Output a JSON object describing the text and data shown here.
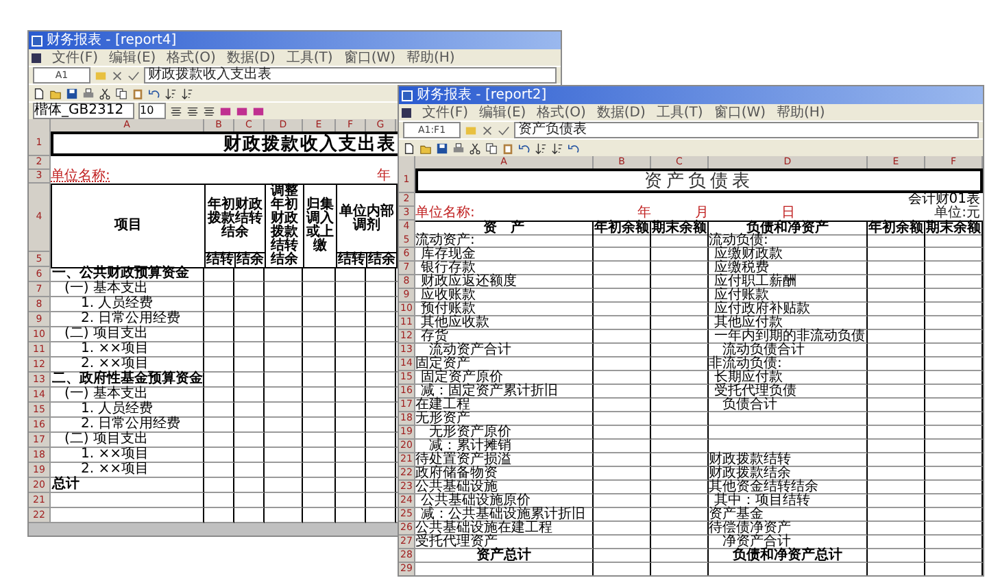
{
  "income_window": {
    "title": "财务报表 - [report4]",
    "menu": [
      "文件(F)",
      "编辑(E)",
      "格式(O)",
      "数据(D)",
      "工具(T)",
      "窗口(W)",
      "帮助(H)"
    ],
    "cell_ref": "A1",
    "formula": "财政拨款收入支出表",
    "font_name": "楷体_GB2312",
    "font_size": "10",
    "columns": [
      "A",
      "B",
      "C",
      "D",
      "E",
      "F",
      "G"
    ],
    "sheet": {
      "row_numbers": [
        "1",
        "2",
        "3",
        "4",
        "5"
      ],
      "title": "财政拨款收入支出表",
      "unit_name": "单位名称:",
      "year": "年",
      "headers": {
        "item": "项目",
        "carryover": "年初财政拨款结转结余",
        "adjust": "调整年初财政拨款结转结余",
        "transfer": "归集调入或上缴",
        "internal": "单位内部调剂",
        "sub": [
          "结转",
          "结余",
          "结转",
          "结余"
        ]
      },
      "rows": [
        {
          "n": "6",
          "label": "一、公共财政预算资金",
          "kind": "section"
        },
        {
          "n": "7",
          "label": "(一) 基本支出",
          "kind": "group"
        },
        {
          "n": "8",
          "label": "1. 人员经费",
          "kind": "item"
        },
        {
          "n": "9",
          "label": "2. 日常公用经费",
          "kind": "item"
        },
        {
          "n": "10",
          "label": "(二) 项目支出",
          "kind": "group"
        },
        {
          "n": "11",
          "label": "1. ××项目",
          "kind": "item"
        },
        {
          "n": "12",
          "label": "2. ××项目",
          "kind": "item"
        },
        {
          "n": "13",
          "label": "二、政府性基金预算资金",
          "kind": "section"
        },
        {
          "n": "14",
          "label": "(一) 基本支出",
          "kind": "group"
        },
        {
          "n": "15",
          "label": "1. 人员经费",
          "kind": "item"
        },
        {
          "n": "16",
          "label": "2. 日常公用经费",
          "kind": "item"
        },
        {
          "n": "17",
          "label": "(二) 项目支出",
          "kind": "group"
        },
        {
          "n": "18",
          "label": "1. ××项目",
          "kind": "item"
        },
        {
          "n": "19",
          "label": "2. ××项目",
          "kind": "item"
        },
        {
          "n": "20",
          "label": "总计",
          "kind": "total"
        },
        {
          "n": "21"
        },
        {
          "n": "22"
        }
      ]
    }
  },
  "balance_window": {
    "title": "财务报表 - [report2]",
    "menu": [
      "文件(F)",
      "编辑(E)",
      "格式(O)",
      "数据(D)",
      "工具(T)",
      "窗口(W)",
      "帮助(H)"
    ],
    "cell_ref": "A1:F1",
    "formula": "资产负债表",
    "columns": [
      "A",
      "B",
      "C",
      "D",
      "E",
      "F"
    ],
    "sheet": {
      "row_numbers": [
        "1",
        "2",
        "3",
        "4"
      ],
      "title": "资产负债表",
      "form_no": "会计财01表",
      "unit_name": "单位名称:",
      "year": "年",
      "month": "月",
      "day": "日",
      "currency": "单位:元",
      "headers": [
        "资　产",
        "年初余额",
        "期末余额",
        "负债和净资产",
        "年初余额",
        "期末余额"
      ],
      "rows": [
        {
          "n": "5",
          "asset": {
            "text": "流动资产:",
            "kind": "head"
          },
          "liability": {
            "text": "流动负债:",
            "kind": "head"
          }
        },
        {
          "n": "6",
          "asset": {
            "text": "库存现金",
            "kind": "item"
          },
          "liability": {
            "text": "应缴财政款",
            "kind": "item"
          }
        },
        {
          "n": "7",
          "asset": {
            "text": "银行存款",
            "kind": "item"
          },
          "liability": {
            "text": "应缴税费",
            "kind": "item"
          }
        },
        {
          "n": "8",
          "asset": {
            "text": "财政应返还额度",
            "kind": "item"
          },
          "liability": {
            "text": "应付职工薪酬",
            "kind": "item"
          }
        },
        {
          "n": "9",
          "asset": {
            "text": "应收账款",
            "kind": "item"
          },
          "liability": {
            "text": "应付账款",
            "kind": "item"
          }
        },
        {
          "n": "10",
          "asset": {
            "text": "预付账款",
            "kind": "item"
          },
          "liability": {
            "text": "应付政府补贴款",
            "kind": "item"
          }
        },
        {
          "n": "11",
          "asset": {
            "text": "其他应收款",
            "kind": "item"
          },
          "liability": {
            "text": "其他应付款",
            "kind": "item"
          }
        },
        {
          "n": "12",
          "asset": {
            "text": "存货",
            "kind": "item"
          },
          "liability": {
            "text": "一年内到期的非流动负债",
            "kind": "item"
          }
        },
        {
          "n": "13",
          "asset": {
            "text": "流动资产合计",
            "kind": "sub"
          },
          "liability": {
            "text": "流动负债合计",
            "kind": "sub"
          }
        },
        {
          "n": "14",
          "asset": {
            "text": "固定资产",
            "kind": "head"
          },
          "liability": {
            "text": "非流动负债:",
            "kind": "head"
          }
        },
        {
          "n": "15",
          "asset": {
            "text": "固定资产原价",
            "kind": "item"
          },
          "liability": {
            "text": "长期应付款",
            "kind": "item"
          }
        },
        {
          "n": "16",
          "asset": {
            "text": "减：固定资产累计折旧",
            "kind": "item"
          },
          "liability": {
            "text": "受托代理负债",
            "kind": "item"
          }
        },
        {
          "n": "17",
          "asset": {
            "text": "在建工程",
            "kind": "head"
          },
          "liability": {
            "text": "负债合计",
            "kind": "sub"
          }
        },
        {
          "n": "18",
          "asset": {
            "text": "无形资产",
            "kind": "head"
          }
        },
        {
          "n": "19",
          "asset": {
            "text": "无形资产原价",
            "kind": "sub"
          }
        },
        {
          "n": "20",
          "asset": {
            "text": "减：累计摊销",
            "kind": "sub"
          }
        },
        {
          "n": "21",
          "asset": {
            "text": "待处置资产损溢",
            "kind": "head"
          },
          "liability": {
            "text": "财政拨款结转",
            "kind": "head"
          }
        },
        {
          "n": "22",
          "asset": {
            "text": "政府储备物资",
            "kind": "head"
          },
          "liability": {
            "text": "财政拨款结余",
            "kind": "head"
          }
        },
        {
          "n": "23",
          "asset": {
            "text": "公共基础设施",
            "kind": "head"
          },
          "liability": {
            "text": "其他资金结转结余",
            "kind": "head"
          }
        },
        {
          "n": "24",
          "asset": {
            "text": "公共基础设施原价",
            "kind": "item"
          },
          "liability": {
            "text": "其中：项目结转",
            "kind": "item"
          }
        },
        {
          "n": "25",
          "asset": {
            "text": "减：公共基础设施累计折旧",
            "kind": "item"
          },
          "liability": {
            "text": "资产基金",
            "kind": "head"
          }
        },
        {
          "n": "26",
          "asset": {
            "text": "公共基础设施在建工程",
            "kind": "head"
          },
          "liability": {
            "text": "待偿债净资产",
            "kind": "head"
          }
        },
        {
          "n": "27",
          "asset": {
            "text": "受托代理资产",
            "kind": "head"
          },
          "liability": {
            "text": "净资产合计",
            "kind": "sub"
          }
        },
        {
          "n": "28",
          "asset": {
            "text": "资产总计",
            "kind": "total"
          },
          "liability": {
            "text": "负债和净资产总计",
            "kind": "total"
          }
        },
        {
          "n": "29"
        }
      ]
    }
  }
}
